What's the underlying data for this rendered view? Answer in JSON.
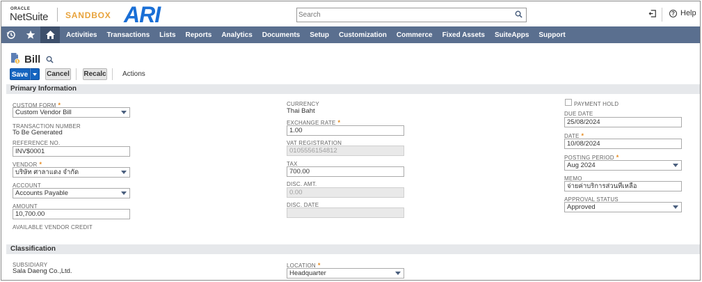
{
  "header": {
    "logo_oracle": "ORACLE",
    "logo_netsuite": "NetSuite",
    "environment": "SANDBOX",
    "company_logo": "ARI",
    "search_placeholder": "Search",
    "help_label": "Help"
  },
  "nav": {
    "icons": [
      "recent-records-icon",
      "favorites-star-icon",
      "home-icon"
    ],
    "items": [
      "Activities",
      "Transactions",
      "Lists",
      "Reports",
      "Analytics",
      "Documents",
      "Setup",
      "Customization",
      "Commerce",
      "Fixed Assets",
      "SuiteApps",
      "Support"
    ]
  },
  "page": {
    "title": "Bill"
  },
  "actions": {
    "save": "Save",
    "cancel": "Cancel",
    "recalc": "Recalc",
    "actions": "Actions"
  },
  "sections": {
    "primary": "Primary Information",
    "classification": "Classification"
  },
  "fields": {
    "custom_form": {
      "label": "CUSTOM FORM",
      "value": "Custom Vendor Bill"
    },
    "transaction_number": {
      "label": "TRANSACTION NUMBER",
      "value": "To Be Generated"
    },
    "reference_no": {
      "label": "REFERENCE NO.",
      "value": "INV$0001"
    },
    "vendor": {
      "label": "VENDOR",
      "value": "บริษัท ศาลาแดง จำกัด"
    },
    "account": {
      "label": "ACCOUNT",
      "value": "Accounts Payable"
    },
    "amount": {
      "label": "AMOUNT",
      "value": "10,700.00"
    },
    "available_vendor_credit": {
      "label": "AVAILABLE VENDOR CREDIT"
    },
    "currency": {
      "label": "CURRENCY",
      "value": "Thai Baht"
    },
    "exchange_rate": {
      "label": "EXCHANGE RATE",
      "value": "1.00"
    },
    "vat_registration": {
      "label": "VAT REGISTRATION",
      "value": "0105556154812"
    },
    "tax": {
      "label": "TAX",
      "value": "700.00"
    },
    "disc_amt": {
      "label": "DISC. AMT.",
      "value": "0.00"
    },
    "disc_date": {
      "label": "DISC. DATE",
      "value": ""
    },
    "payment_hold": {
      "label": "PAYMENT HOLD",
      "checked": false
    },
    "due_date": {
      "label": "DUE DATE",
      "value": "25/08/2024"
    },
    "date": {
      "label": "DATE",
      "value": "10/08/2024"
    },
    "posting_period": {
      "label": "POSTING PERIOD",
      "value": "Aug 2024"
    },
    "memo": {
      "label": "MEMO",
      "value": "จ่ายค่าบริการส่วนที่เหลือ"
    },
    "approval_status": {
      "label": "APPROVAL STATUS",
      "value": "Approved"
    },
    "subsidiary": {
      "label": "SUBSIDIARY",
      "value": "Sala Daeng Co.,Ltd."
    },
    "location": {
      "label": "LOCATION",
      "value": "Headquarter"
    }
  },
  "required_marker": "*",
  "colors": {
    "nav_bg": "#5a6f8f",
    "nav_home_bg": "#3d4f6b",
    "save_button": "#1565c0",
    "sandbox_text": "#e8a33d",
    "company_logo": "#1a6fd6",
    "required_marker": "#e58a1f",
    "section_bg": "#e6e8eb"
  }
}
